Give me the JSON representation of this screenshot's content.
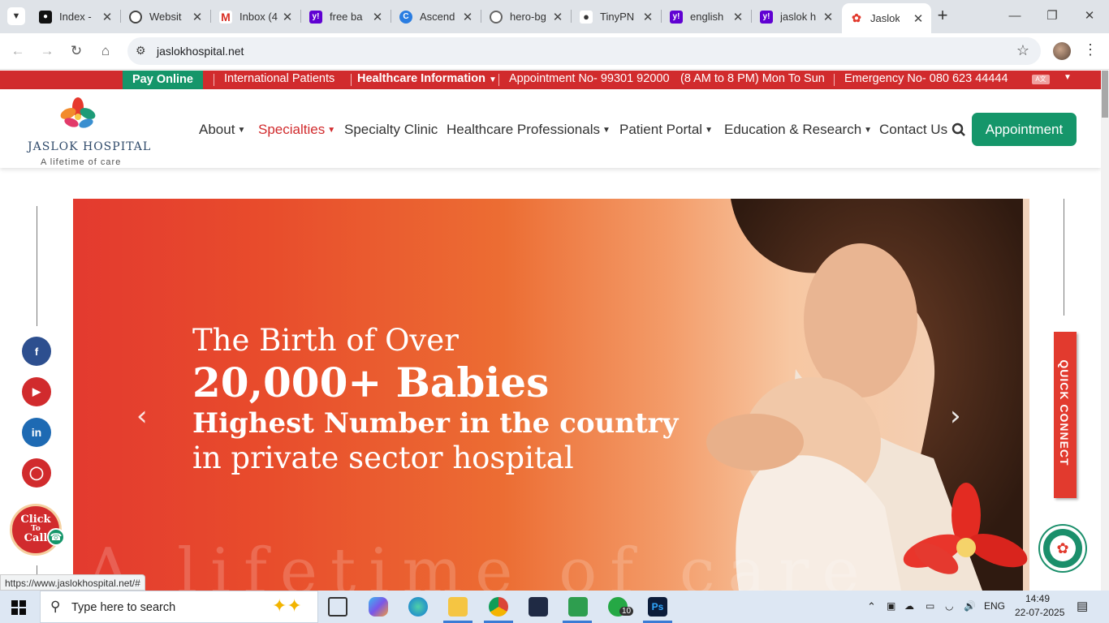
{
  "browser": {
    "tabs": [
      {
        "title": "Index -",
        "icon": "chatgpt-icon",
        "color": "#111111"
      },
      {
        "title": "Websit",
        "icon": "openai-icon",
        "color": "#444444"
      },
      {
        "title": "Inbox (4",
        "icon": "gmail-icon",
        "color": "#d93025"
      },
      {
        "title": "free ba",
        "icon": "yahoo-icon",
        "color": "#6001d2"
      },
      {
        "title": "Ascend",
        "icon": "canva-icon",
        "color": "#2a7de1"
      },
      {
        "title": "hero-bg",
        "icon": "globe-icon",
        "color": "#666666"
      },
      {
        "title": "TinyPN",
        "icon": "panda-icon",
        "color": "#333333"
      },
      {
        "title": "english",
        "icon": "yahoo-icon",
        "color": "#6001d2"
      },
      {
        "title": "jaslok h",
        "icon": "yahoo-icon",
        "color": "#6001d2"
      },
      {
        "title": "Jaslok H",
        "icon": "jaslok-icon",
        "color": "#e23a2e"
      }
    ],
    "new_tab": "+",
    "url": "jaslokhospital.net",
    "status_url": "https://www.jaslokhospital.net/#"
  },
  "topbar": {
    "pay_online": "Pay Online",
    "international": "International Patients",
    "healthcare_info": "Healthcare Information",
    "appointment_no": "Appointment No- 99301 92000",
    "hours": "(8 AM to 8 PM) Mon To Sun",
    "emergency": "Emergency No- 080 623 44444"
  },
  "logo": {
    "name": "JASLOK HOSPITAL",
    "tagline": "A lifetime of care"
  },
  "nav": {
    "about": "About",
    "specialties": "Specialties",
    "specialty_clinic": "Specialty Clinic",
    "healthcare_professionals": "Healthcare Professionals",
    "patient_portal": "Patient Portal",
    "education": "Education & Research",
    "contact": "Contact Us",
    "appointment": "Appointment"
  },
  "hero": {
    "line1": "The Birth of Over",
    "line2": "20,000+ Babies",
    "line3": "Highest Number in the country",
    "line4": "in private sector hospital",
    "watermark": "A lifetime of care"
  },
  "side": {
    "quick_connect": "QUICK CONNECT",
    "click_to_call_1": "Click",
    "click_to_call_2": "To",
    "click_to_call_3": "Call"
  },
  "taskbar": {
    "search_placeholder": "Type here to search",
    "language": "ENG",
    "time": "14:49",
    "date": "22-07-2025",
    "whatsapp_badge": "10"
  },
  "colors": {
    "brand_red": "#d12b2d",
    "brand_green": "#15966a"
  }
}
